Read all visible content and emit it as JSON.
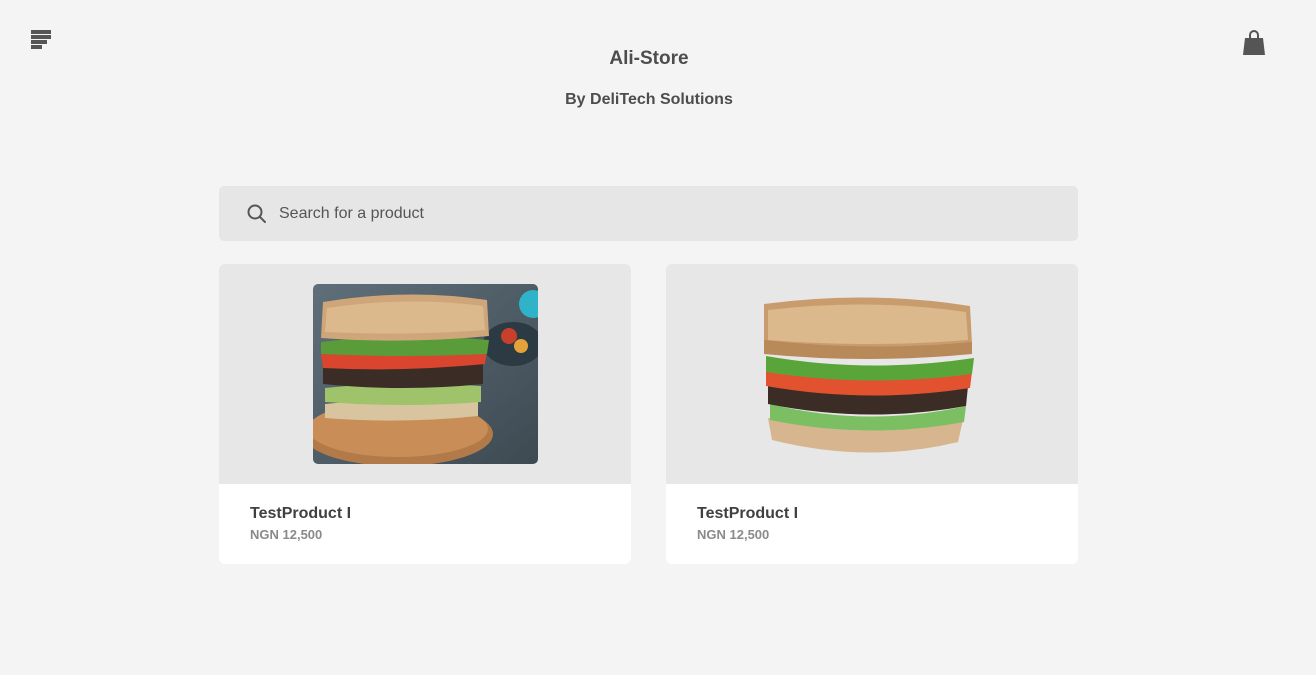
{
  "header": {
    "title": "Ali-Store",
    "subtitle": "By DeliTech Solutions",
    "menu_icon": "menu-icon",
    "cart_icon": "shopping-bag-icon"
  },
  "search": {
    "placeholder": "Search for a product",
    "value": "",
    "icon": "search-icon"
  },
  "products": [
    {
      "name": "TestProduct I",
      "price": "NGN 12,500",
      "image": "sandwich-photo-on-board"
    },
    {
      "name": "TestProduct I",
      "price": "NGN 12,500",
      "image": "sandwich-cutout"
    }
  ],
  "colors": {
    "background": "#f4f4f4",
    "card": "#ffffff",
    "image_area": "#e7e7e7",
    "search_bg": "#e6e6e6",
    "text": "#4d4d4d",
    "price": "#8a8a8a"
  }
}
